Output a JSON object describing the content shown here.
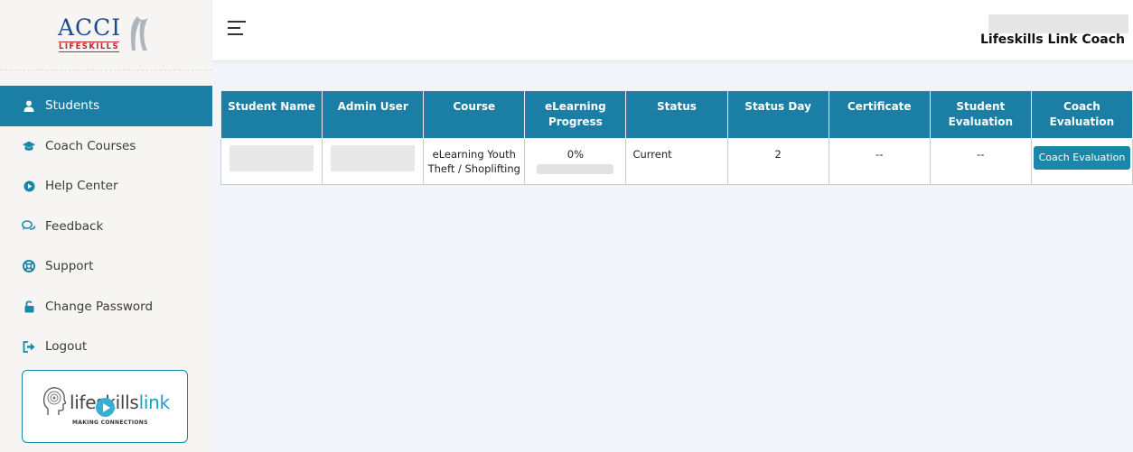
{
  "logo": {
    "text": "ACCI",
    "sub": "LIFESKILLS"
  },
  "nav": [
    {
      "label": "Students",
      "icon": "user-icon",
      "active": true
    },
    {
      "label": "Coach Courses",
      "icon": "graduation-cap-icon"
    },
    {
      "label": "Help Center",
      "icon": "play-circle-icon"
    },
    {
      "label": "Feedback",
      "icon": "chat-icon"
    },
    {
      "label": "Support",
      "icon": "lifebuoy-icon"
    },
    {
      "label": "Change Password",
      "icon": "unlock-icon"
    },
    {
      "label": "Logout",
      "icon": "logout-icon"
    }
  ],
  "promo": {
    "brand_a": "lifeskills",
    "brand_b": "link",
    "tagline": "MAKING CONNECTIONS"
  },
  "header": {
    "title": "Lifeskills Link Coach"
  },
  "table": {
    "columns": [
      "Student Name",
      "Admin User",
      "Course",
      "eLearning Progress",
      "Status",
      "Status Day",
      "Certificate",
      "Student Evaluation",
      "Coach Evaluation"
    ],
    "rows": [
      {
        "course": "eLearning Youth Theft / Shoplifting",
        "progress": "0%",
        "progress_value": 0,
        "status": "Current",
        "status_day": "2",
        "certificate": "--",
        "student_evaluation": "--",
        "coach_evaluation_button": "Coach Evaluation"
      }
    ]
  },
  "colors": {
    "accent": "#1a7ea5",
    "brand_red": "#c0262d",
    "brand_blue": "#1c4a8c"
  }
}
